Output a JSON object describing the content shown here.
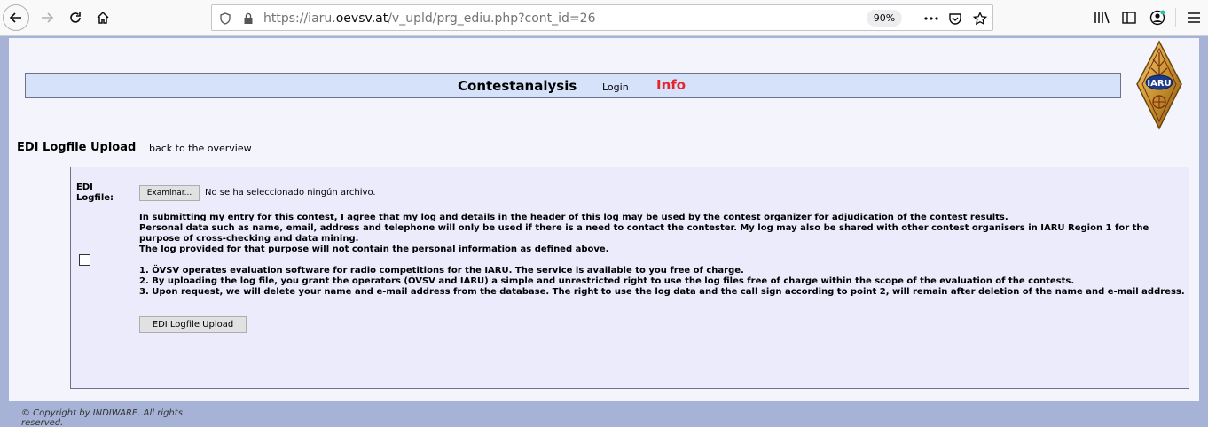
{
  "browser": {
    "url_prefix": "https://iaru.",
    "url_domain": "oevsv.at",
    "url_path": "/v_upld/prg_ediu.php?cont_id=26",
    "zoom": "90%"
  },
  "nav": {
    "title": "Contestanalysis",
    "login": "Login",
    "info": "Info"
  },
  "logo": {
    "text": "IARU"
  },
  "page": {
    "heading": "EDI Logfile Upload",
    "back_link": "back to the overview"
  },
  "form": {
    "edi_label": "EDI\nLogfile:",
    "file_button": "Examinar...",
    "file_status": "No se ha seleccionado ningún archivo.",
    "consent_1": "In submitting my entry for this contest, I agree that my log and details in the header of this log may be used by the contest organizer for adjudication of the contest results.\nPersonal data such as name, email, address and telephone will only be used if there is a need to contact the contester. My log may also be shared with other contest organisers in IARU Region 1 for the\npurpose of cross-checking and data mining.\nThe log provided for that purpose will not contain the personal information as defined above.",
    "point_1": "1. ÖVSV operates evaluation software for radio competitions for the IARU. The service is available to you free of charge.",
    "point_2": "2. By uploading the log file, you grant the operators (ÖVSV and IARU) a simple and unrestricted right to use the log files free of charge within the scope of the evaluation of the contests.",
    "point_3": "3. Upon request, we will delete your name and e-mail address from the database. The right to use the log data and the call sign according to point 2, will remain after deletion of the name and e-mail address.",
    "upload_button": "EDI Logfile Upload",
    "consent_checked": false
  },
  "footer": {
    "prefix": "© Copyright by ",
    "company": "INDIWARE.",
    "suffix": " All rights reserved."
  },
  "colors": {
    "nav_bg": "#d6e2fa",
    "info_red": "#e3262b",
    "page_frame": "#a6b3d6"
  }
}
